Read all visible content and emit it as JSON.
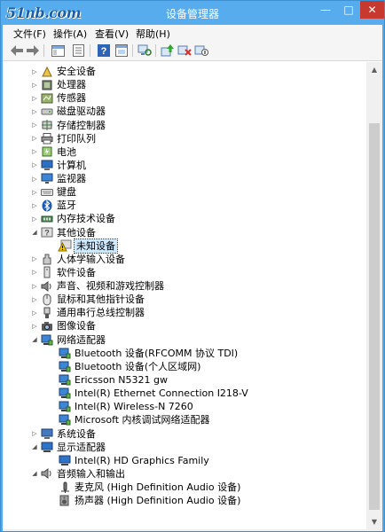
{
  "window": {
    "logo_text": "51nb.com",
    "title": "设备管理器",
    "minimize_glyph": "—",
    "maximize_glyph": "□",
    "close_glyph": "✕"
  },
  "menu": [
    {
      "label": "文件(F)"
    },
    {
      "label": "操作(A)"
    },
    {
      "label": "查看(V)"
    },
    {
      "label": "帮助(H)"
    }
  ],
  "toolbar": {
    "buttons": [
      "back-arrow-icon",
      "forward-arrow-icon",
      "show-hide-icon",
      "properties-icon",
      "help-icon",
      "view-icon",
      "scan-hardware-icon",
      "update-driver-icon",
      "uninstall-icon",
      "disable-icon"
    ]
  },
  "colors": {
    "titlebar": "#56acec",
    "close": "#c7392f",
    "selection": "#cde8ff"
  },
  "tree": [
    {
      "label": "安全设备",
      "level": 0,
      "expander": "collapsed",
      "icon": "security-device-icon"
    },
    {
      "label": "处理器",
      "level": 0,
      "expander": "collapsed",
      "icon": "processor-icon"
    },
    {
      "label": "传感器",
      "level": 0,
      "expander": "collapsed",
      "icon": "sensor-icon"
    },
    {
      "label": "磁盘驱动器",
      "level": 0,
      "expander": "collapsed",
      "icon": "disk-drive-icon"
    },
    {
      "label": "存储控制器",
      "level": 0,
      "expander": "collapsed",
      "icon": "storage-controller-icon"
    },
    {
      "label": "打印队列",
      "level": 0,
      "expander": "collapsed",
      "icon": "printer-icon"
    },
    {
      "label": "电池",
      "level": 0,
      "expander": "collapsed",
      "icon": "battery-icon"
    },
    {
      "label": "计算机",
      "level": 0,
      "expander": "collapsed",
      "icon": "computer-icon"
    },
    {
      "label": "监视器",
      "level": 0,
      "expander": "collapsed",
      "icon": "monitor-icon"
    },
    {
      "label": "键盘",
      "level": 0,
      "expander": "collapsed",
      "icon": "keyboard-icon"
    },
    {
      "label": "蓝牙",
      "level": 0,
      "expander": "collapsed",
      "icon": "bluetooth-icon"
    },
    {
      "label": "内存技术设备",
      "level": 0,
      "expander": "collapsed",
      "icon": "memory-device-icon"
    },
    {
      "label": "其他设备",
      "level": 0,
      "expander": "expanded",
      "icon": "other-devices-icon"
    },
    {
      "label": "未知设备",
      "level": 1,
      "expander": "none",
      "icon": "warning-icon",
      "selected": true
    },
    {
      "label": "人体学输入设备",
      "level": 0,
      "expander": "collapsed",
      "icon": "hid-icon"
    },
    {
      "label": "软件设备",
      "level": 0,
      "expander": "collapsed",
      "icon": "software-device-icon"
    },
    {
      "label": "声音、视频和游戏控制器",
      "level": 0,
      "expander": "collapsed",
      "icon": "sound-icon"
    },
    {
      "label": "鼠标和其他指针设备",
      "level": 0,
      "expander": "collapsed",
      "icon": "mouse-icon"
    },
    {
      "label": "通用串行总线控制器",
      "level": 0,
      "expander": "collapsed",
      "icon": "usb-icon"
    },
    {
      "label": "图像设备",
      "level": 0,
      "expander": "collapsed",
      "icon": "camera-icon"
    },
    {
      "label": "网络适配器",
      "level": 0,
      "expander": "expanded",
      "icon": "network-adapter-icon"
    },
    {
      "label": "Bluetooth 设备(RFCOMM 协议 TDI)",
      "level": 1,
      "expander": "none",
      "icon": "network-adapter-icon"
    },
    {
      "label": "Bluetooth 设备(个人区域网)",
      "level": 1,
      "expander": "none",
      "icon": "network-adapter-icon"
    },
    {
      "label": "Ericsson N5321 gw",
      "level": 1,
      "expander": "none",
      "icon": "network-adapter-icon"
    },
    {
      "label": "Intel(R) Ethernet Connection I218-V",
      "level": 1,
      "expander": "none",
      "icon": "network-adapter-icon"
    },
    {
      "label": "Intel(R) Wireless-N 7260",
      "level": 1,
      "expander": "none",
      "icon": "network-adapter-icon"
    },
    {
      "label": "Microsoft 内核调试网络适配器",
      "level": 1,
      "expander": "none",
      "icon": "network-adapter-icon"
    },
    {
      "label": "系统设备",
      "level": 0,
      "expander": "collapsed",
      "icon": "system-device-icon"
    },
    {
      "label": "显示适配器",
      "level": 0,
      "expander": "expanded",
      "icon": "display-adapter-icon"
    },
    {
      "label": "Intel(R) HD Graphics Family",
      "level": 1,
      "expander": "none",
      "icon": "display-adapter-icon"
    },
    {
      "label": "音频输入和输出",
      "level": 0,
      "expander": "expanded",
      "icon": "audio-io-icon"
    },
    {
      "label": "麦克风 (High Definition Audio 设备)",
      "level": 1,
      "expander": "none",
      "icon": "microphone-icon"
    },
    {
      "label": "扬声器 (High Definition Audio 设备)",
      "level": 1,
      "expander": "none",
      "icon": "speaker-icon"
    }
  ]
}
